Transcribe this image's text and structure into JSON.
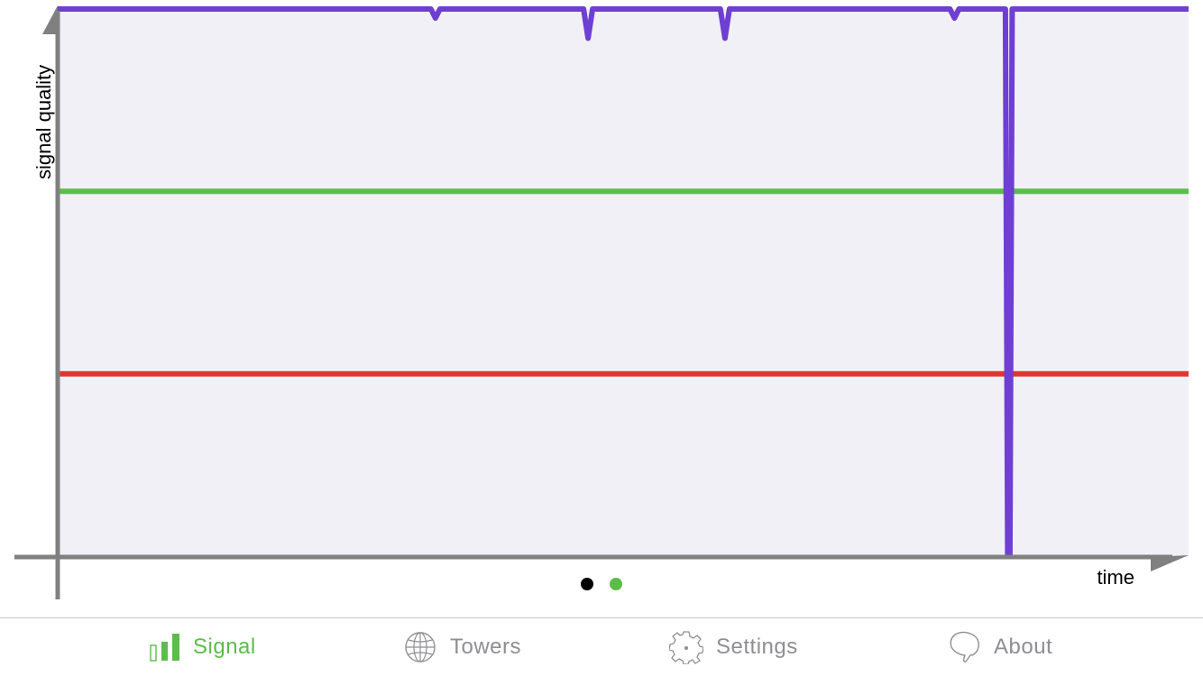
{
  "chart_data": {
    "type": "line",
    "title": "",
    "xlabel": "time",
    "ylabel": "signal quality",
    "ylim": [
      0,
      3
    ],
    "xlim": [
      0,
      100
    ],
    "grid": false,
    "legend": "none",
    "series": [
      {
        "color": "#6e3fd2",
        "x": [
          0,
          33.0,
          33.4,
          33.8,
          46.5,
          46.9,
          47.3,
          58.6,
          59.0,
          59.4,
          78.9,
          79.3,
          79.7,
          83.8,
          84.0,
          84.2,
          84.4,
          100
        ],
        "values": [
          3,
          3,
          2.95,
          3,
          3,
          2.84,
          3,
          3,
          2.84,
          3,
          3,
          2.95,
          3,
          3,
          0,
          0,
          3,
          3
        ]
      },
      {
        "color": "#5bbd4a",
        "x": [
          0,
          100
        ],
        "values": [
          2,
          2
        ]
      },
      {
        "color": "#e0342f",
        "x": [
          0,
          100
        ],
        "values": [
          1,
          1
        ]
      }
    ]
  },
  "colors": {
    "plot_background": "#f1f0f6",
    "axis": "#808080",
    "accent": "#5bbd4a",
    "inactive": "#8e8e93",
    "dot_active": "#000000",
    "dot_inactive": "#5bbd4a"
  },
  "page_indicator": {
    "count": 2,
    "current": 1
  },
  "tabs": [
    {
      "label": "Signal",
      "icon": "signal-bars-icon",
      "active": true
    },
    {
      "label": "Towers",
      "icon": "globe-icon",
      "active": false
    },
    {
      "label": "Settings",
      "icon": "gear-icon",
      "active": false
    },
    {
      "label": "About",
      "icon": "speech-bubble-icon",
      "active": false
    }
  ]
}
